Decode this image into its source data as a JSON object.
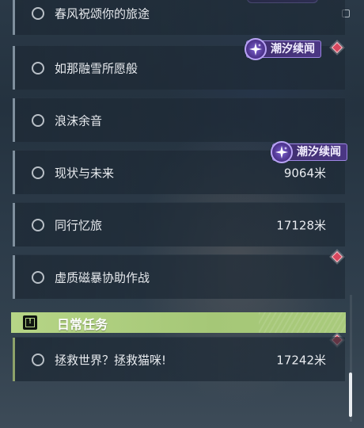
{
  "quests": [
    {
      "title": "春风祝颂你的旅途",
      "distance": ""
    },
    {
      "title": "如那融雪所愿般",
      "distance": ""
    },
    {
      "title": "浪沫余音",
      "distance": ""
    },
    {
      "title": "现状与未来",
      "distance": "9064米"
    },
    {
      "title": "同行忆旅",
      "distance": "17128米"
    },
    {
      "title": "虚质磁暴协助作战",
      "distance": ""
    }
  ],
  "badges": {
    "tide_label": "潮汐续闻"
  },
  "daily_section": {
    "title": "日常任务",
    "quests": [
      {
        "title": "拯救世界？拯救猫咪!",
        "distance": "17242米"
      }
    ]
  },
  "colors": {
    "daily_accent": "#b6d586",
    "badge_purple": "#4b3784",
    "marker_red": "#d8475e"
  }
}
